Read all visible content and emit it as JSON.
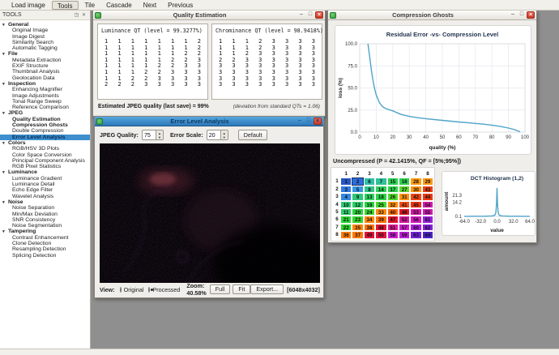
{
  "app": {
    "menu": [
      "Load image",
      "Tools",
      "Tile",
      "Cascade",
      "Next",
      "Previous"
    ],
    "active_menu": "Tools"
  },
  "sidebar": {
    "title": "TOOLS",
    "sections": [
      {
        "label": "General",
        "items": [
          {
            "label": "Original Image"
          },
          {
            "label": "Image Digest"
          },
          {
            "label": "Similarity Search"
          },
          {
            "label": "Automatic Tagging"
          }
        ]
      },
      {
        "label": "File",
        "items": [
          {
            "label": "Metadata Extraction"
          },
          {
            "label": "EXIF Structure"
          },
          {
            "label": "Thumbnail Analysis"
          },
          {
            "label": "Geolocation Data"
          }
        ]
      },
      {
        "label": "Inspection",
        "items": [
          {
            "label": "Enhancing Magnifier"
          },
          {
            "label": "Image Adjustments"
          },
          {
            "label": "Tonal Range Sweep"
          },
          {
            "label": "Reference Comparison"
          }
        ]
      },
      {
        "label": "JPEG",
        "items": [
          {
            "label": "Quality Estimation",
            "bold": true
          },
          {
            "label": "Compression Ghosts",
            "bold": true
          },
          {
            "label": "Double Compression"
          },
          {
            "label": "Error Level Analysis",
            "bold": true,
            "selected": true
          }
        ]
      },
      {
        "label": "Colors",
        "items": [
          {
            "label": "RGB/HSV 3D Plots"
          },
          {
            "label": "Color Space Conversion"
          },
          {
            "label": "Principal Component Analysis"
          },
          {
            "label": "RGB Pixel Statistics"
          }
        ]
      },
      {
        "label": "Luminance",
        "items": [
          {
            "label": "Luminance Gradient"
          },
          {
            "label": "Luminance Detail"
          },
          {
            "label": "Echo Edge Filter"
          },
          {
            "label": "Wavelet Analysis"
          }
        ]
      },
      {
        "label": "Noise",
        "items": [
          {
            "label": "Noise Separation"
          },
          {
            "label": "Min/Max Deviation"
          },
          {
            "label": "SNR Consistency"
          },
          {
            "label": "Noise Segmentation"
          }
        ]
      },
      {
        "label": "Tampering",
        "items": [
          {
            "label": "Contrast Enhancement"
          },
          {
            "label": "Clone Detection"
          },
          {
            "label": "Resampling Detection"
          },
          {
            "label": "Splicing Detection"
          }
        ]
      }
    ]
  },
  "quality_estimation": {
    "title": "Quality Estimation",
    "luminance_title": "Luminance QT (level = 99.3277%)",
    "luminance_table": [
      [
        1,
        1,
        1,
        1,
        1,
        1,
        1,
        2
      ],
      [
        1,
        1,
        1,
        1,
        1,
        1,
        1,
        2
      ],
      [
        1,
        1,
        1,
        1,
        1,
        1,
        2,
        2
      ],
      [
        1,
        1,
        1,
        1,
        1,
        2,
        2,
        3
      ],
      [
        1,
        1,
        1,
        1,
        2,
        2,
        3,
        3
      ],
      [
        1,
        1,
        1,
        2,
        2,
        3,
        3,
        3
      ],
      [
        1,
        1,
        2,
        2,
        3,
        3,
        3,
        3
      ],
      [
        2,
        2,
        2,
        3,
        3,
        3,
        3,
        3
      ]
    ],
    "chrominance_title": "Chrominance QT (level = 98.9418%)",
    "chrominance_table": [
      [
        1,
        1,
        1,
        2,
        3,
        3,
        3,
        3
      ],
      [
        1,
        1,
        1,
        2,
        3,
        3,
        3,
        3
      ],
      [
        1,
        1,
        2,
        3,
        3,
        3,
        3,
        3
      ],
      [
        2,
        2,
        3,
        3,
        3,
        3,
        3,
        3
      ],
      [
        3,
        3,
        3,
        3,
        3,
        3,
        3,
        3
      ],
      [
        3,
        3,
        3,
        3,
        3,
        3,
        3,
        3
      ],
      [
        3,
        3,
        3,
        3,
        3,
        3,
        3,
        3
      ],
      [
        3,
        3,
        3,
        3,
        3,
        3,
        3,
        3
      ]
    ],
    "status_left": "Estimated JPEG quality (last save) = 99%",
    "status_right": "(deviation from standard QTs = 1.06)"
  },
  "error_level_analysis": {
    "title": "Error Level Analysis",
    "jpeg_quality_label": "JPEG Quality:",
    "jpeg_quality_value": "75",
    "error_scale_label": "Error Scale:",
    "error_scale_value": "20",
    "default_button": "Default",
    "view_label": "View:",
    "radio_original": "Original",
    "radio_processed": "Processed",
    "processed_selected": true,
    "zoom_label": "Zoom: 40.58%",
    "full_button": "Full",
    "fit_button": "Fit",
    "export_button": "Export...",
    "image_size": "[6048x4032]"
  },
  "compression_ghosts": {
    "title": "Compression Ghosts",
    "uncompressed_label": "Uncompressed (P = 42.1415%, QF = [5%;95%])",
    "zigzag": {
      "col_headers": [
        "1",
        "2",
        "3",
        "4",
        "5",
        "6",
        "7",
        "8"
      ],
      "row_headers": [
        "1",
        "2",
        "3",
        "4",
        "5",
        "6",
        "7",
        "8"
      ],
      "values": [
        [
          1,
          2,
          6,
          7,
          15,
          16,
          28,
          29
        ],
        [
          3,
          5,
          8,
          14,
          17,
          27,
          30,
          43
        ],
        [
          4,
          9,
          13,
          18,
          26,
          31,
          42,
          44
        ],
        [
          10,
          12,
          19,
          25,
          32,
          41,
          45,
          54
        ],
        [
          11,
          20,
          24,
          33,
          40,
          46,
          53,
          55
        ],
        [
          21,
          23,
          34,
          39,
          47,
          52,
          56,
          61
        ],
        [
          22,
          35,
          38,
          48,
          51,
          57,
          60,
          62
        ],
        [
          36,
          37,
          49,
          50,
          58,
          59,
          63,
          64
        ]
      ],
      "selected_cell": {
        "row": 1,
        "col": 2
      },
      "color_anchors": [
        [
          1,
          222,
          68,
          46
        ],
        [
          2,
          218,
          72,
          52
        ],
        [
          5,
          208,
          78,
          56
        ],
        [
          6,
          170,
          60,
          47
        ],
        [
          9,
          150,
          62,
          48
        ],
        [
          13,
          138,
          64,
          50
        ],
        [
          20,
          126,
          66,
          50
        ],
        [
          27,
          105,
          70,
          52
        ],
        [
          28,
          35,
          100,
          54
        ],
        [
          35,
          30,
          100,
          52
        ],
        [
          40,
          24,
          100,
          51
        ],
        [
          41,
          15,
          90,
          52
        ],
        [
          45,
          9,
          86,
          50
        ],
        [
          46,
          355,
          84,
          48
        ],
        [
          50,
          347,
          84,
          48
        ],
        [
          51,
          322,
          80,
          48
        ],
        [
          55,
          310,
          78,
          47
        ],
        [
          58,
          298,
          76,
          47
        ],
        [
          60,
          285,
          76,
          50
        ],
        [
          62,
          272,
          75,
          50
        ],
        [
          63,
          265,
          73,
          50
        ],
        [
          64,
          255,
          72,
          46
        ]
      ]
    }
  },
  "chart_data": [
    {
      "type": "line",
      "title": "Residual Error -vs- Compression Level",
      "xlabel": "quality (%)",
      "ylabel": "loss (%)",
      "xlim": [
        0,
        100
      ],
      "ylim": [
        0,
        100
      ],
      "grid": true,
      "line_color": "#4fa3c9",
      "x_ticks": [
        {
          "v": 0,
          "l": "0"
        },
        {
          "v": 10,
          "l": "10"
        },
        {
          "v": 20,
          "l": "20"
        },
        {
          "v": 30,
          "l": "30"
        },
        {
          "v": 40,
          "l": "40"
        },
        {
          "v": 50,
          "l": "50"
        },
        {
          "v": 60,
          "l": "60"
        },
        {
          "v": 70,
          "l": "70"
        },
        {
          "v": 80,
          "l": "80"
        },
        {
          "v": 90,
          "l": "90"
        },
        {
          "v": 100,
          "l": "100"
        }
      ],
      "y_ticks": [
        {
          "v": 0,
          "l": "0.0"
        },
        {
          "v": 25,
          "l": "25.0"
        },
        {
          "v": 50,
          "l": "50.0"
        },
        {
          "v": 75,
          "l": "75.0"
        },
        {
          "v": 100,
          "l": "100.0"
        }
      ],
      "x": [
        5,
        6,
        7,
        8,
        9,
        10,
        12,
        14,
        16,
        18,
        20,
        25,
        30,
        35,
        40,
        45,
        50,
        55,
        60,
        65,
        70,
        75,
        80,
        85,
        90,
        93,
        95,
        97
      ],
      "y": [
        100,
        86,
        71,
        59,
        49,
        42,
        33,
        28.5,
        26.5,
        25.2,
        24,
        20,
        17.8,
        16.3,
        15.2,
        14.2,
        13.3,
        12.4,
        11.5,
        10.7,
        9.8,
        9,
        7.9,
        6.5,
        4.6,
        3.2,
        1.8,
        0.4
      ]
    },
    {
      "type": "line",
      "title": "DCT Histogram (1,2)",
      "xlabel": "value",
      "ylabel": "amount",
      "xlim": [
        -64,
        64
      ],
      "ylim": [
        0.1,
        30
      ],
      "grid": false,
      "line_color": "#4fa3c9",
      "x_ticks": [
        {
          "v": -64,
          "l": "-64.0"
        },
        {
          "v": -32,
          "l": "-32.0"
        },
        {
          "v": 0,
          "l": "0.0"
        },
        {
          "v": 32,
          "l": "32.0"
        },
        {
          "v": 64,
          "l": "64.0"
        }
      ],
      "y_ticks": [
        {
          "v": 0.1,
          "l": "0.1"
        },
        {
          "v": 14.2,
          "l": "14.2"
        },
        {
          "v": 21.3,
          "l": "21.3"
        }
      ],
      "x": [
        -64,
        -40,
        -24,
        -16,
        -10,
        -6,
        -4,
        -3,
        -2,
        -1,
        0,
        1,
        2,
        3,
        4,
        6,
        10,
        16,
        24,
        40,
        64
      ],
      "y": [
        0.2,
        0.25,
        0.3,
        0.4,
        0.55,
        0.9,
        1.6,
        2.6,
        5,
        13,
        28,
        13,
        5,
        2.6,
        1.6,
        0.9,
        0.55,
        0.4,
        0.3,
        0.25,
        0.2
      ]
    }
  ]
}
